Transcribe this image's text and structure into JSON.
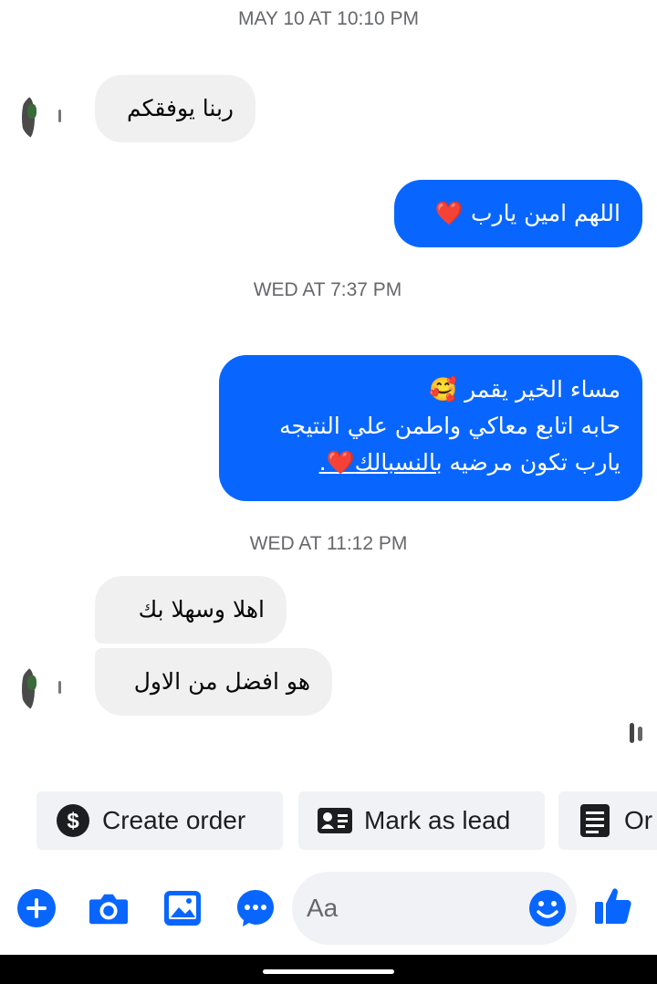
{
  "timestamps": [
    "MAY 10 AT 10:10 PM",
    "WED AT 7:37 PM",
    "WED AT 11:12 PM"
  ],
  "messages": {
    "m1": "ربنا يوفقكم",
    "m2": "اللهم امين يارب",
    "m2_emoji": "❤️",
    "m3_line1": "مساء الخير يقمر",
    "m3_line1_emoji": "🥰",
    "m3_line2": "حابه اتابع معاكي واطمن علي النتيجه",
    "m3_line3_a": "يارب تكون مرضيه ",
    "m3_line3_b": "بالنسبالك",
    "m3_line3_emoji": "❤️",
    "m3_line3_end": ".",
    "m4": "اهلا وسهلا بك",
    "m5": "هو افضل من الاول"
  },
  "quick_actions": [
    {
      "label": "Create order",
      "icon": "dollar-circle-icon"
    },
    {
      "label": "Mark as lead",
      "icon": "contact-card-icon"
    },
    {
      "label": "Or",
      "icon": "list-document-icon"
    }
  ],
  "composer": {
    "placeholder": "Aa"
  },
  "toolbar_icons": [
    "plus-icon",
    "camera-icon",
    "image-icon",
    "chat-bubble-icon",
    "emoji-icon",
    "thumbs-up-icon"
  ],
  "colors": {
    "accent": "#0866ff",
    "incoming": "#f0f0f0",
    "heart": "#e41e3f"
  }
}
